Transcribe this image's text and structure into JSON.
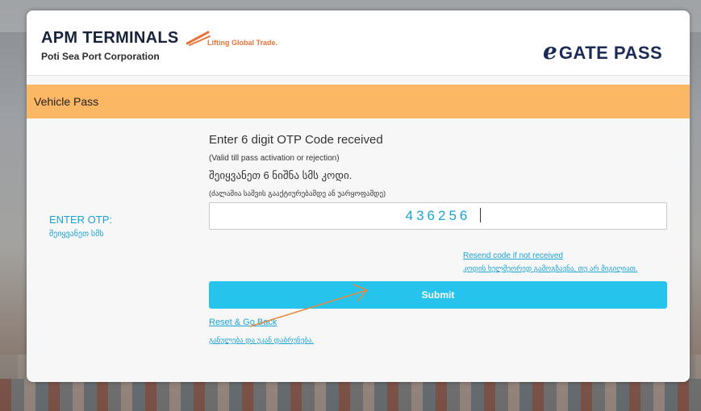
{
  "header": {
    "company": "APM TERMINALS",
    "tagline": "Lifting Global Trade.",
    "subtitle": "Poti Sea Port Corporation",
    "product_e": "e",
    "product": "GATE PASS"
  },
  "banner": {
    "title": "Vehicle Pass"
  },
  "otp": {
    "label": "ENTER OTP:",
    "label_ka": "შეიყვანეთ სმს",
    "instruction": "Enter 6 digit OTP Code received",
    "validity": "(Valid till pass activation or rejection)",
    "instruction_ka": "შეიყვანეთ 6 ნიშნა სმს კოდი.",
    "validity_ka": "(ძალაშია საშვის გააქტიურებამდე ან უარყოფამდე)",
    "value": "436256"
  },
  "links": {
    "resend": "Resend code if not received",
    "resend_ka": "კოდის ხელმეორედ გამოგზავნა, თუ არ მიგიღიათ.",
    "reset": "Reset & Go Back",
    "reset_ka": "განულება და უკან დაბრუნება."
  },
  "submit": {
    "label": "Submit"
  },
  "colors": {
    "accent": "#26c4ec",
    "banner": "#fbb763",
    "link": "#1aa3d4",
    "brand_orange": "#e8743b",
    "brand_navy": "#1c2a56",
    "annotation_arrow": "#e8893e"
  }
}
